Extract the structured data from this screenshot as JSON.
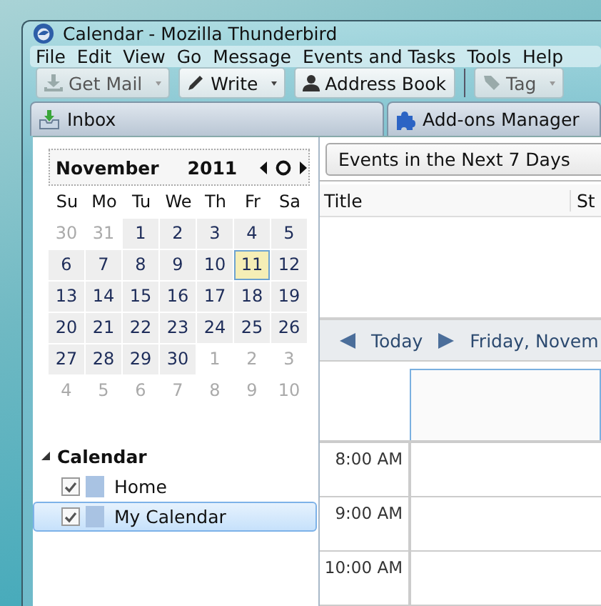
{
  "window": {
    "title": "Calendar - Mozilla Thunderbird"
  },
  "menu": [
    "File",
    "Edit",
    "View",
    "Go",
    "Message",
    "Events and Tasks",
    "Tools",
    "Help"
  ],
  "toolbar": [
    {
      "label": "Get Mail",
      "kind": "getmail",
      "disabled": true,
      "dropdown": true
    },
    {
      "label": "Write",
      "kind": "write",
      "disabled": false,
      "dropdown": true
    },
    {
      "label": "Address Book",
      "kind": "addressbook",
      "disabled": false,
      "dropdown": false
    },
    {
      "label": "Tag",
      "kind": "tag",
      "disabled": true,
      "dropdown": true
    }
  ],
  "tabs": [
    {
      "label": "Inbox",
      "kind": "inbox",
      "selected": false
    },
    {
      "label": "Add-ons Manager",
      "kind": "addons",
      "selected": false
    }
  ],
  "minimonth": {
    "month": "November",
    "year": "2011",
    "weekdays": [
      "Su",
      "Mo",
      "Tu",
      "We",
      "Th",
      "Fr",
      "Sa"
    ],
    "days": [
      {
        "label": "30",
        "current": false,
        "selected": false
      },
      {
        "label": "31",
        "current": false,
        "selected": false
      },
      {
        "label": "1",
        "current": true,
        "selected": false
      },
      {
        "label": "2",
        "current": true,
        "selected": false
      },
      {
        "label": "3",
        "current": true,
        "selected": false
      },
      {
        "label": "4",
        "current": true,
        "selected": false
      },
      {
        "label": "5",
        "current": true,
        "selected": false
      },
      {
        "label": "6",
        "current": true,
        "selected": false
      },
      {
        "label": "7",
        "current": true,
        "selected": false
      },
      {
        "label": "8",
        "current": true,
        "selected": false
      },
      {
        "label": "9",
        "current": true,
        "selected": false
      },
      {
        "label": "10",
        "current": true,
        "selected": false
      },
      {
        "label": "11",
        "current": true,
        "selected": true
      },
      {
        "label": "12",
        "current": true,
        "selected": false
      },
      {
        "label": "13",
        "current": true,
        "selected": false
      },
      {
        "label": "14",
        "current": true,
        "selected": false
      },
      {
        "label": "15",
        "current": true,
        "selected": false
      },
      {
        "label": "16",
        "current": true,
        "selected": false
      },
      {
        "label": "17",
        "current": true,
        "selected": false
      },
      {
        "label": "18",
        "current": true,
        "selected": false
      },
      {
        "label": "19",
        "current": true,
        "selected": false
      },
      {
        "label": "20",
        "current": true,
        "selected": false
      },
      {
        "label": "21",
        "current": true,
        "selected": false
      },
      {
        "label": "22",
        "current": true,
        "selected": false
      },
      {
        "label": "23",
        "current": true,
        "selected": false
      },
      {
        "label": "24",
        "current": true,
        "selected": false
      },
      {
        "label": "25",
        "current": true,
        "selected": false
      },
      {
        "label": "26",
        "current": true,
        "selected": false
      },
      {
        "label": "27",
        "current": true,
        "selected": false
      },
      {
        "label": "28",
        "current": true,
        "selected": false
      },
      {
        "label": "29",
        "current": true,
        "selected": false
      },
      {
        "label": "30",
        "current": true,
        "selected": false
      },
      {
        "label": "1",
        "current": false,
        "selected": false
      },
      {
        "label": "2",
        "current": false,
        "selected": false
      },
      {
        "label": "3",
        "current": false,
        "selected": false
      },
      {
        "label": "4",
        "current": false,
        "selected": false
      },
      {
        "label": "5",
        "current": false,
        "selected": false
      },
      {
        "label": "6",
        "current": false,
        "selected": false
      },
      {
        "label": "7",
        "current": false,
        "selected": false
      },
      {
        "label": "8",
        "current": false,
        "selected": false
      },
      {
        "label": "9",
        "current": false,
        "selected": false
      },
      {
        "label": "10",
        "current": false,
        "selected": false
      }
    ]
  },
  "calendar_list": {
    "heading": "Calendar",
    "expanded": true,
    "items": [
      {
        "name": "Home",
        "checked": true,
        "color": "#a9c3e3",
        "selected": false
      },
      {
        "name": "My Calendar",
        "checked": true,
        "color": "#a9c3e3",
        "selected": true
      }
    ]
  },
  "events_filter": {
    "value": "Events in the Next 7 Days"
  },
  "event_list": {
    "columns": [
      "Title",
      "St"
    ]
  },
  "day_nav": {
    "today": "Today",
    "date": "Friday, Novem"
  },
  "day_view": {
    "hours": [
      "8:00 AM",
      "9:00 AM",
      "10:00 AM"
    ]
  }
}
